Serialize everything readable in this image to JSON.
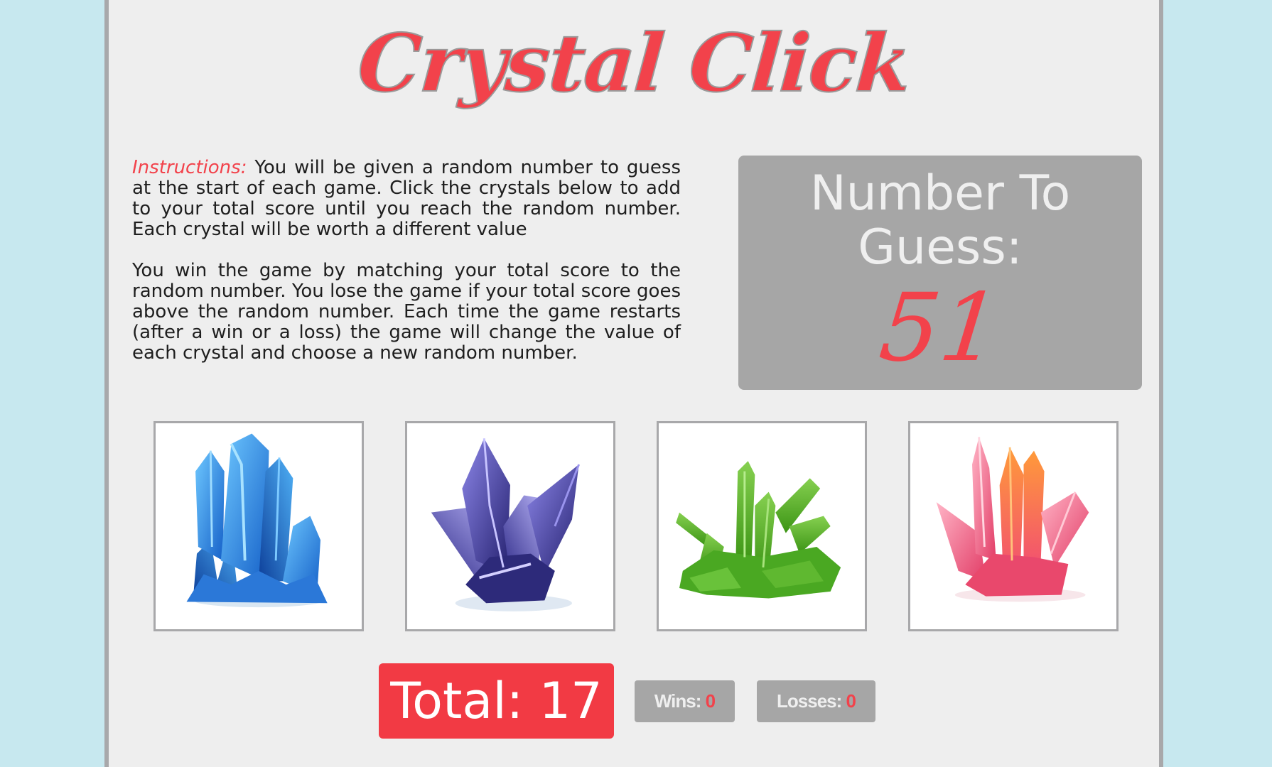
{
  "title": "Crystal Click",
  "instructions": {
    "label": "Instructions:",
    "paragraph1": " You will be given a random number to guess at the start of each game. Click the crystals below to add to your total score until you reach the random number. Each crystal will be worth a different value",
    "paragraph2": "You win the game by matching your total score to the random number. You lose the game if your total score goes above the random number. Each time the game restarts (after a win or a loss) the game will change the value of each crystal and choose a new random number."
  },
  "target": {
    "label": "Number To Guess:",
    "value": "51"
  },
  "crystals": [
    {
      "name": "blue-crystal",
      "icon": "blue-crystal-icon",
      "color": "#1e8ee6"
    },
    {
      "name": "purple-crystal",
      "icon": "purple-crystal-icon",
      "color": "#3a3a9a"
    },
    {
      "name": "green-crystal",
      "icon": "green-crystal-icon",
      "color": "#4aa822"
    },
    {
      "name": "pink-crystal",
      "icon": "pink-crystal-icon",
      "color": "#ee5878"
    }
  ],
  "score": {
    "total_label": "Total: 17",
    "wins_label": "Wins:",
    "wins_value": "0",
    "losses_label": "Losses:",
    "losses_value": "0"
  },
  "colors": {
    "accent_red": "#f2424b",
    "panel_gray": "#a6a6a6",
    "page_background": "#c7e8ef",
    "content_background": "#eeeeee"
  }
}
